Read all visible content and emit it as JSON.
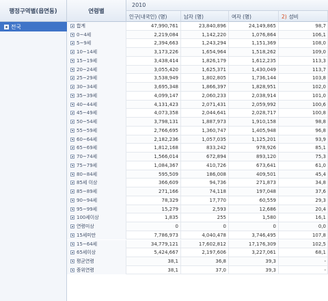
{
  "header": {
    "region_col": "행정구역별(읍면동)",
    "age_col": "연령별",
    "year": "2010",
    "columns": {
      "total": "인구(내국인) (명)",
      "male": "남자 (명)",
      "female": "여자 (명)",
      "ratio_note": "2)",
      "ratio": "성비"
    }
  },
  "region": {
    "selected": "전국"
  },
  "rows": [
    {
      "age": "합계",
      "total": "47,990,761",
      "male": "23,840,896",
      "female": "24,149,865",
      "ratio": "98,7"
    },
    {
      "age": "0~4세",
      "total": "2,219,084",
      "male": "1,142,220",
      "female": "1,076,864",
      "ratio": "106,1"
    },
    {
      "age": "5~9세",
      "total": "2,394,663",
      "male": "1,243,294",
      "female": "1,151,369",
      "ratio": "108,0"
    },
    {
      "age": "10~14세",
      "total": "3,173,226",
      "male": "1,654,964",
      "female": "1,518,262",
      "ratio": "109,0"
    },
    {
      "age": "15~19세",
      "total": "3,438,414",
      "male": "1,826,179",
      "female": "1,612,235",
      "ratio": "113,3"
    },
    {
      "age": "20~24세",
      "total": "3,055,420",
      "male": "1,625,371",
      "female": "1,430,049",
      "ratio": "113,7"
    },
    {
      "age": "25~29세",
      "total": "3,538,949",
      "male": "1,802,805",
      "female": "1,736,144",
      "ratio": "103,8"
    },
    {
      "age": "30~34세",
      "total": "3,695,348",
      "male": "1,866,397",
      "female": "1,828,951",
      "ratio": "102,0"
    },
    {
      "age": "35~39세",
      "total": "4,099,147",
      "male": "2,060,233",
      "female": "2,038,914",
      "ratio": "101,0"
    },
    {
      "age": "40~44세",
      "total": "4,131,423",
      "male": "2,071,431",
      "female": "2,059,992",
      "ratio": "100,6"
    },
    {
      "age": "45~49세",
      "total": "4,073,358",
      "male": "2,044,641",
      "female": "2,028,717",
      "ratio": "100,8"
    },
    {
      "age": "50~54세",
      "total": "3,798,131",
      "male": "1,887,973",
      "female": "1,910,158",
      "ratio": "98,8"
    },
    {
      "age": "55~59세",
      "total": "2,766,695",
      "male": "1,360,747",
      "female": "1,405,948",
      "ratio": "96,8"
    },
    {
      "age": "60~64세",
      "total": "2,182,236",
      "male": "1,057,035",
      "female": "1,125,201",
      "ratio": "93,9"
    },
    {
      "age": "65~69세",
      "total": "1,812,168",
      "male": "833,242",
      "female": "978,926",
      "ratio": "85,1"
    },
    {
      "age": "70~74세",
      "total": "1,566,014",
      "male": "672,894",
      "female": "893,120",
      "ratio": "75,3"
    },
    {
      "age": "75~79세",
      "total": "1,084,367",
      "male": "410,726",
      "female": "673,641",
      "ratio": "61,0"
    },
    {
      "age": "80~84세",
      "total": "595,509",
      "male": "186,008",
      "female": "409,501",
      "ratio": "45,4"
    },
    {
      "age": "85세 이상",
      "total": "366,609",
      "male": "94,736",
      "female": "271,873",
      "ratio": "34,8"
    },
    {
      "age": "85~89세",
      "total": "271,166",
      "male": "74,118",
      "female": "197,048",
      "ratio": "37,6"
    },
    {
      "age": "90~94세",
      "total": "78,329",
      "male": "17,770",
      "female": "60,559",
      "ratio": "29,3"
    },
    {
      "age": "95~99세",
      "total": "15,279",
      "male": "2,593",
      "female": "12,686",
      "ratio": "20,4"
    },
    {
      "age": "100세이상",
      "total": "1,835",
      "male": "255",
      "female": "1,580",
      "ratio": "16,1"
    },
    {
      "age": "연령미상",
      "total": "0",
      "male": "0",
      "female": "0",
      "ratio": "0,0"
    },
    {
      "age": "15세미만",
      "total": "7,786,973",
      "male": "4,040,478",
      "female": "3,746,495",
      "ratio": "107,8"
    },
    {
      "age": "15~64세",
      "total": "34,779,121",
      "male": "17,602,812",
      "female": "17,176,309",
      "ratio": "102,5"
    },
    {
      "age": "65세이상",
      "total": "5,424,667",
      "male": "2,197,606",
      "female": "3,227,061",
      "ratio": "68,1"
    },
    {
      "age": "평균연령",
      "total": "38,1",
      "male": "36,8",
      "female": "39,3",
      "ratio": "-"
    },
    {
      "age": "중위연령",
      "total": "38,1",
      "male": "37,0",
      "female": "39,3",
      "ratio": "-"
    }
  ]
}
